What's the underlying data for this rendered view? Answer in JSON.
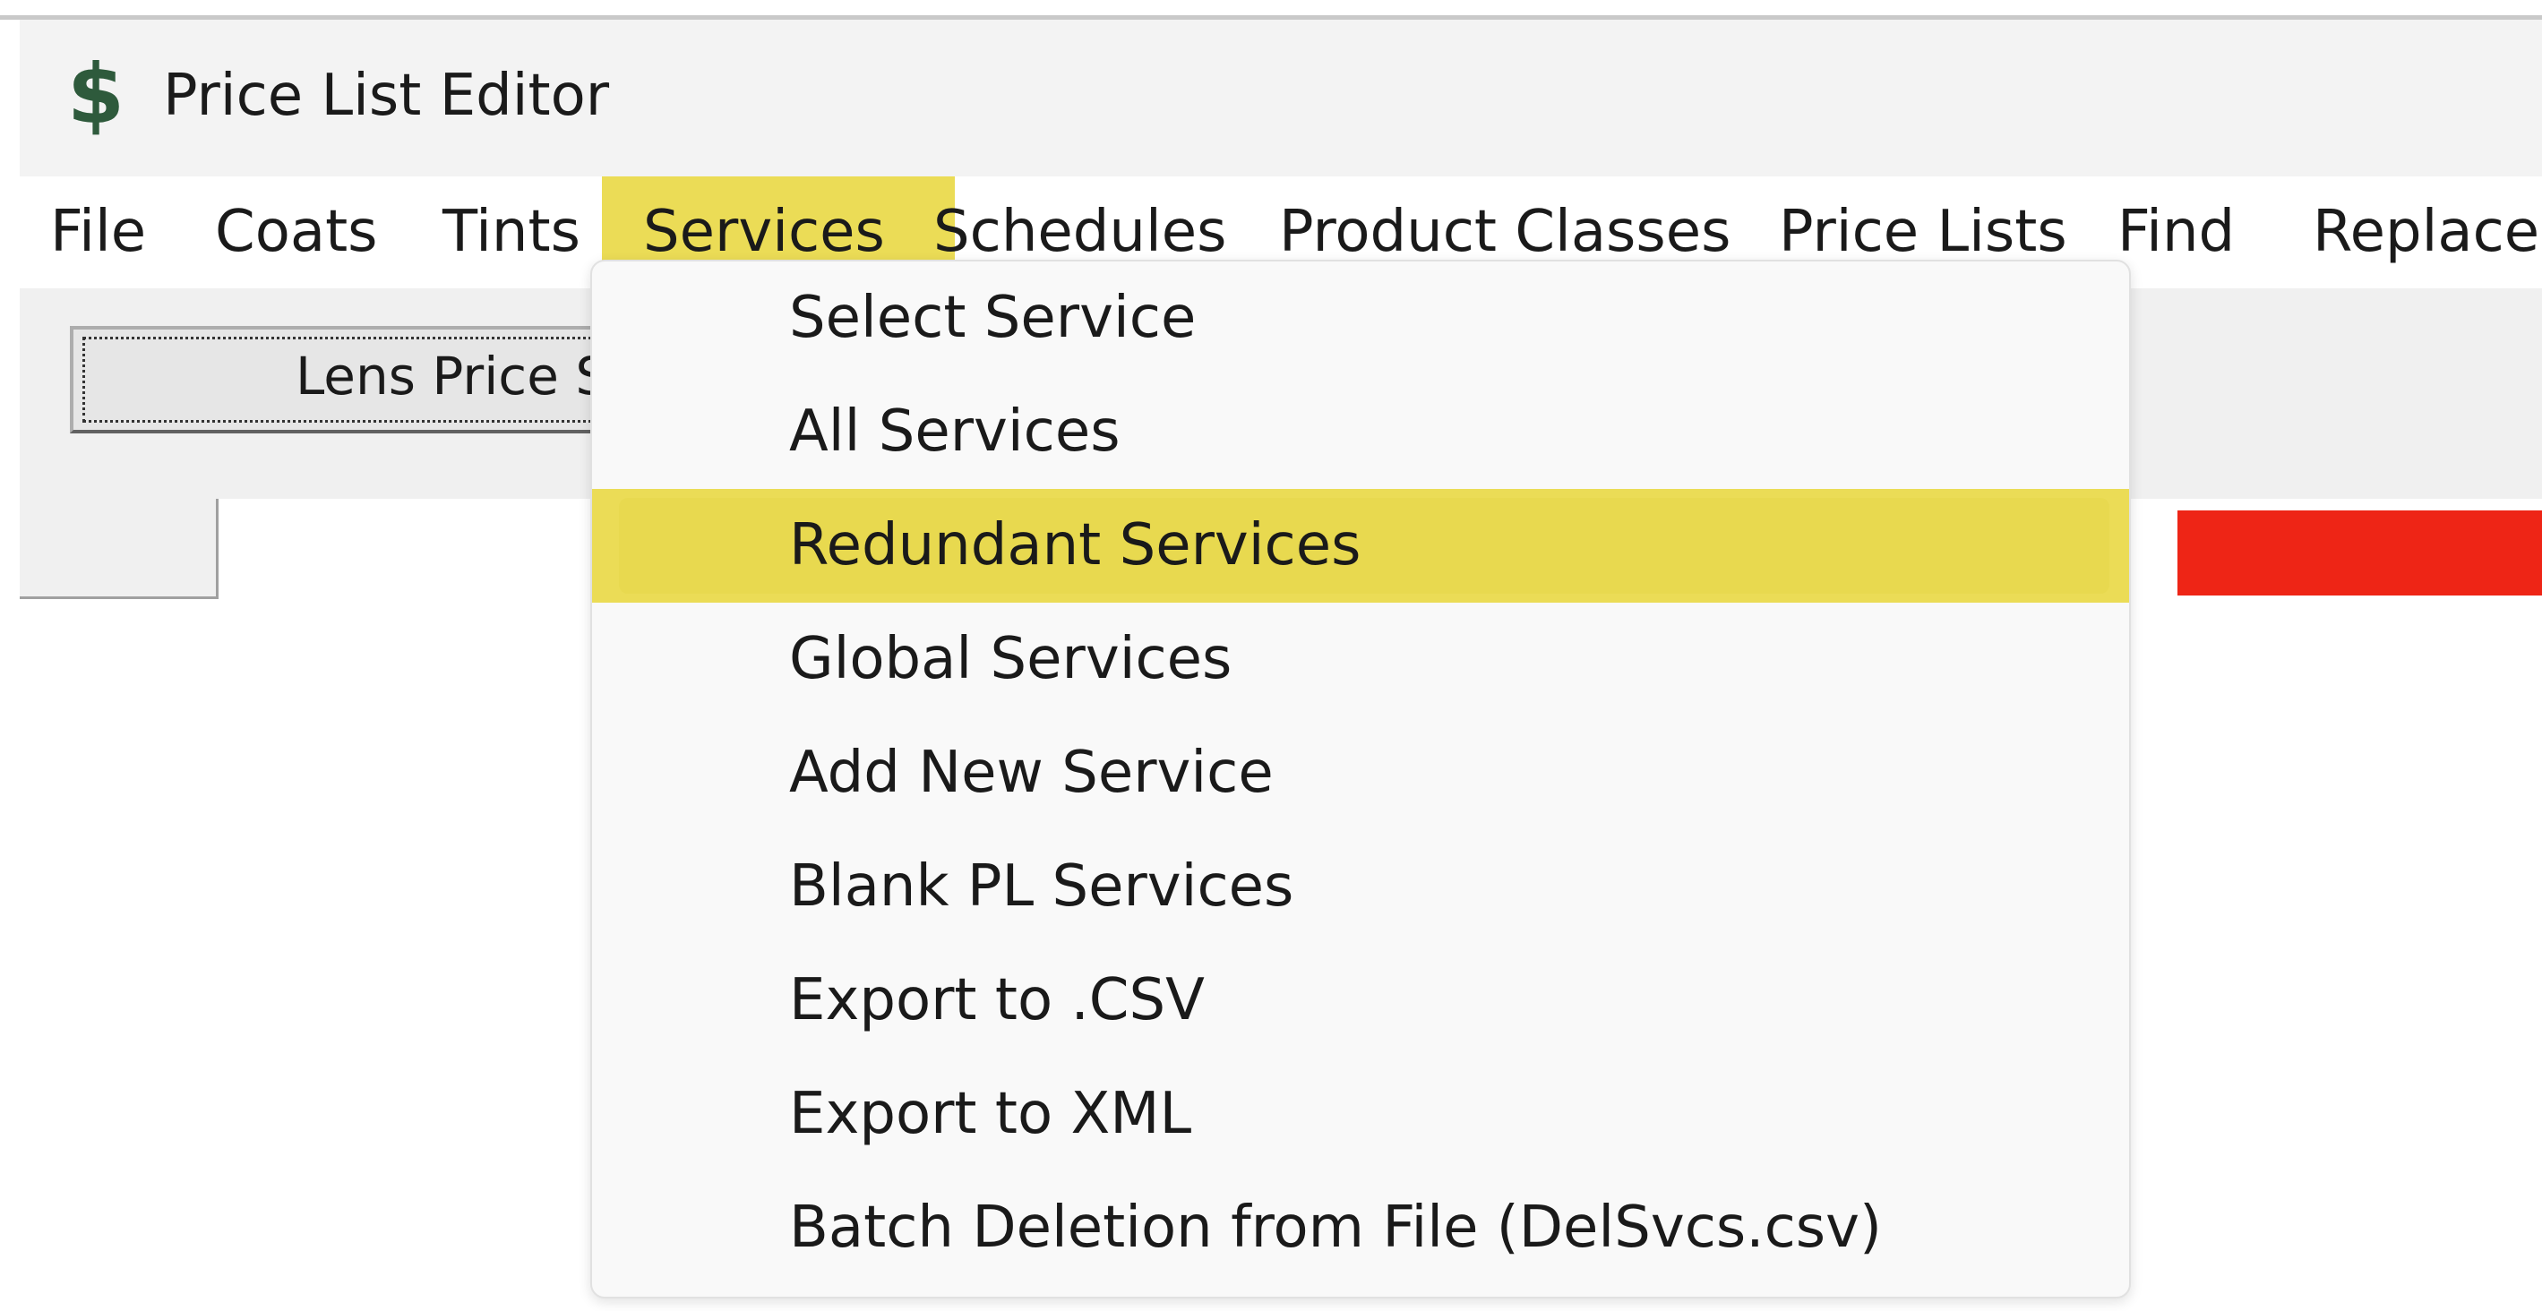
{
  "window": {
    "title": "Price List Editor",
    "icon": "dollar-icon",
    "icon_glyph": "$"
  },
  "menubar": {
    "items": [
      {
        "label": "File"
      },
      {
        "label": "Coats"
      },
      {
        "label": "Tints"
      },
      {
        "label": "Services"
      },
      {
        "label": "Schedules"
      },
      {
        "label": "Product Classes"
      },
      {
        "label": "Price Lists"
      },
      {
        "label": "Find"
      },
      {
        "label": "Replace"
      }
    ],
    "active": "Services"
  },
  "toolbar": {
    "lens_button_label": "Lens Price Se"
  },
  "services_menu": {
    "items": [
      {
        "label": "Select Service"
      },
      {
        "label": "All Services"
      },
      {
        "label": "Redundant Services"
      },
      {
        "label": "Global Services"
      },
      {
        "label": "Add New Service"
      },
      {
        "label": "Blank PL Services"
      },
      {
        "label": "Export to .CSV"
      },
      {
        "label": "Export to XML"
      },
      {
        "label": "Batch Deletion from File (DelSvcs.csv)"
      }
    ],
    "highlighted": "Redundant Services"
  },
  "colors": {
    "highlight": "#ebdc56",
    "red_bar": "#ee2516",
    "icon_green": "#2e5a3c"
  }
}
